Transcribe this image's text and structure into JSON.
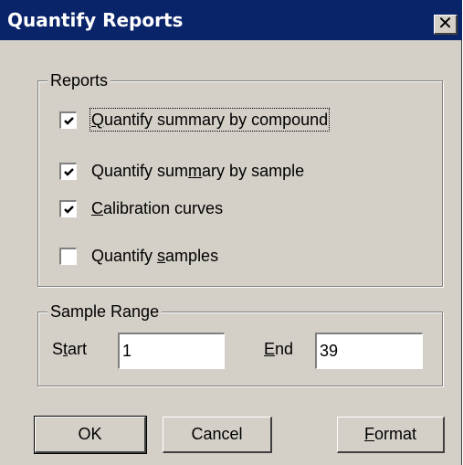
{
  "window": {
    "title": "Quantify Reports",
    "close_glyph": "✕"
  },
  "reports_group": {
    "legend": "Reports",
    "items": [
      {
        "label_pre": "",
        "label_u": "Q",
        "label_post": "uantify summary by compound",
        "checked": true,
        "focused": true
      },
      {
        "label_pre": "Quantify sum",
        "label_u": "m",
        "label_post": "ary by sample",
        "checked": true,
        "focused": false
      },
      {
        "label_pre": "",
        "label_u": "C",
        "label_post": "alibration curves",
        "checked": true,
        "focused": false
      },
      {
        "label_pre": "Quantify ",
        "label_u": "s",
        "label_post": "amples",
        "checked": false,
        "focused": false
      }
    ]
  },
  "sample_range_group": {
    "legend": "Sample Range",
    "start": {
      "label_pre": "S",
      "label_u": "t",
      "label_post": "art",
      "value": "1"
    },
    "end": {
      "label_pre": "",
      "label_u": "E",
      "label_post": "nd",
      "value": "39"
    }
  },
  "buttons": {
    "ok": "OK",
    "cancel": "Cancel",
    "format_u": "F",
    "format_post": "ormat"
  }
}
